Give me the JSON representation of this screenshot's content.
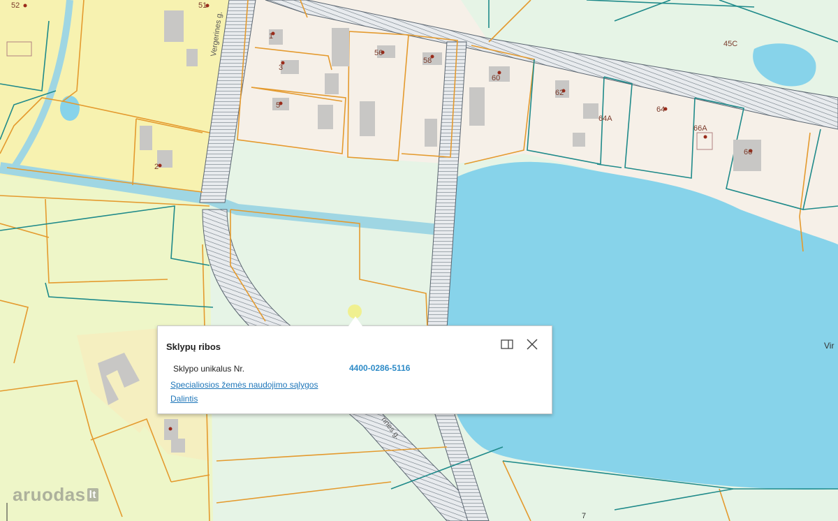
{
  "map": {
    "house_numbers": [
      {
        "id": "n52",
        "text": "52"
      },
      {
        "id": "n51",
        "text": "51"
      },
      {
        "id": "n1",
        "text": "1"
      },
      {
        "id": "n3",
        "text": "3"
      },
      {
        "id": "n5",
        "text": "5"
      },
      {
        "id": "n56a",
        "text": "56"
      },
      {
        "id": "n58",
        "text": "58"
      },
      {
        "id": "n60",
        "text": "60"
      },
      {
        "id": "n62",
        "text": "62"
      },
      {
        "id": "n64a",
        "text": "64A"
      },
      {
        "id": "n64",
        "text": "64"
      },
      {
        "id": "n66a",
        "text": "66A"
      },
      {
        "id": "n66",
        "text": "66"
      },
      {
        "id": "n45c",
        "text": "45C"
      },
      {
        "id": "n2",
        "text": "2"
      },
      {
        "id": "n7",
        "text": "7"
      }
    ],
    "street_labels": {
      "top": "Vergerines g.",
      "bottom": "rines g."
    },
    "edge_label": "Vir",
    "colors": {
      "water": "#87d3ea",
      "residential": "#f6f0e8",
      "yellow_zone": "#f7f2b0",
      "meadow": "#e6f4e6",
      "green_zone": "#eef6c8",
      "parcel_line_orange": "#e49a2e",
      "parcel_line_teal": "#1f8a8a",
      "road": "#9aa3ab",
      "link": "#1e76b9",
      "parcel_id": "#2e8bc7"
    }
  },
  "popup": {
    "title": "Sklypų ribos",
    "key": "Sklypo unikalus Nr.",
    "value": "4400-0286-5116",
    "link_special": "Specialiosios žemės naudojimo sąlygos",
    "link_share": "Dalintis",
    "dock_icon": "dock-icon",
    "close_icon": "close-icon"
  },
  "watermark": {
    "brand": "aruodas",
    "tld": "lt"
  }
}
